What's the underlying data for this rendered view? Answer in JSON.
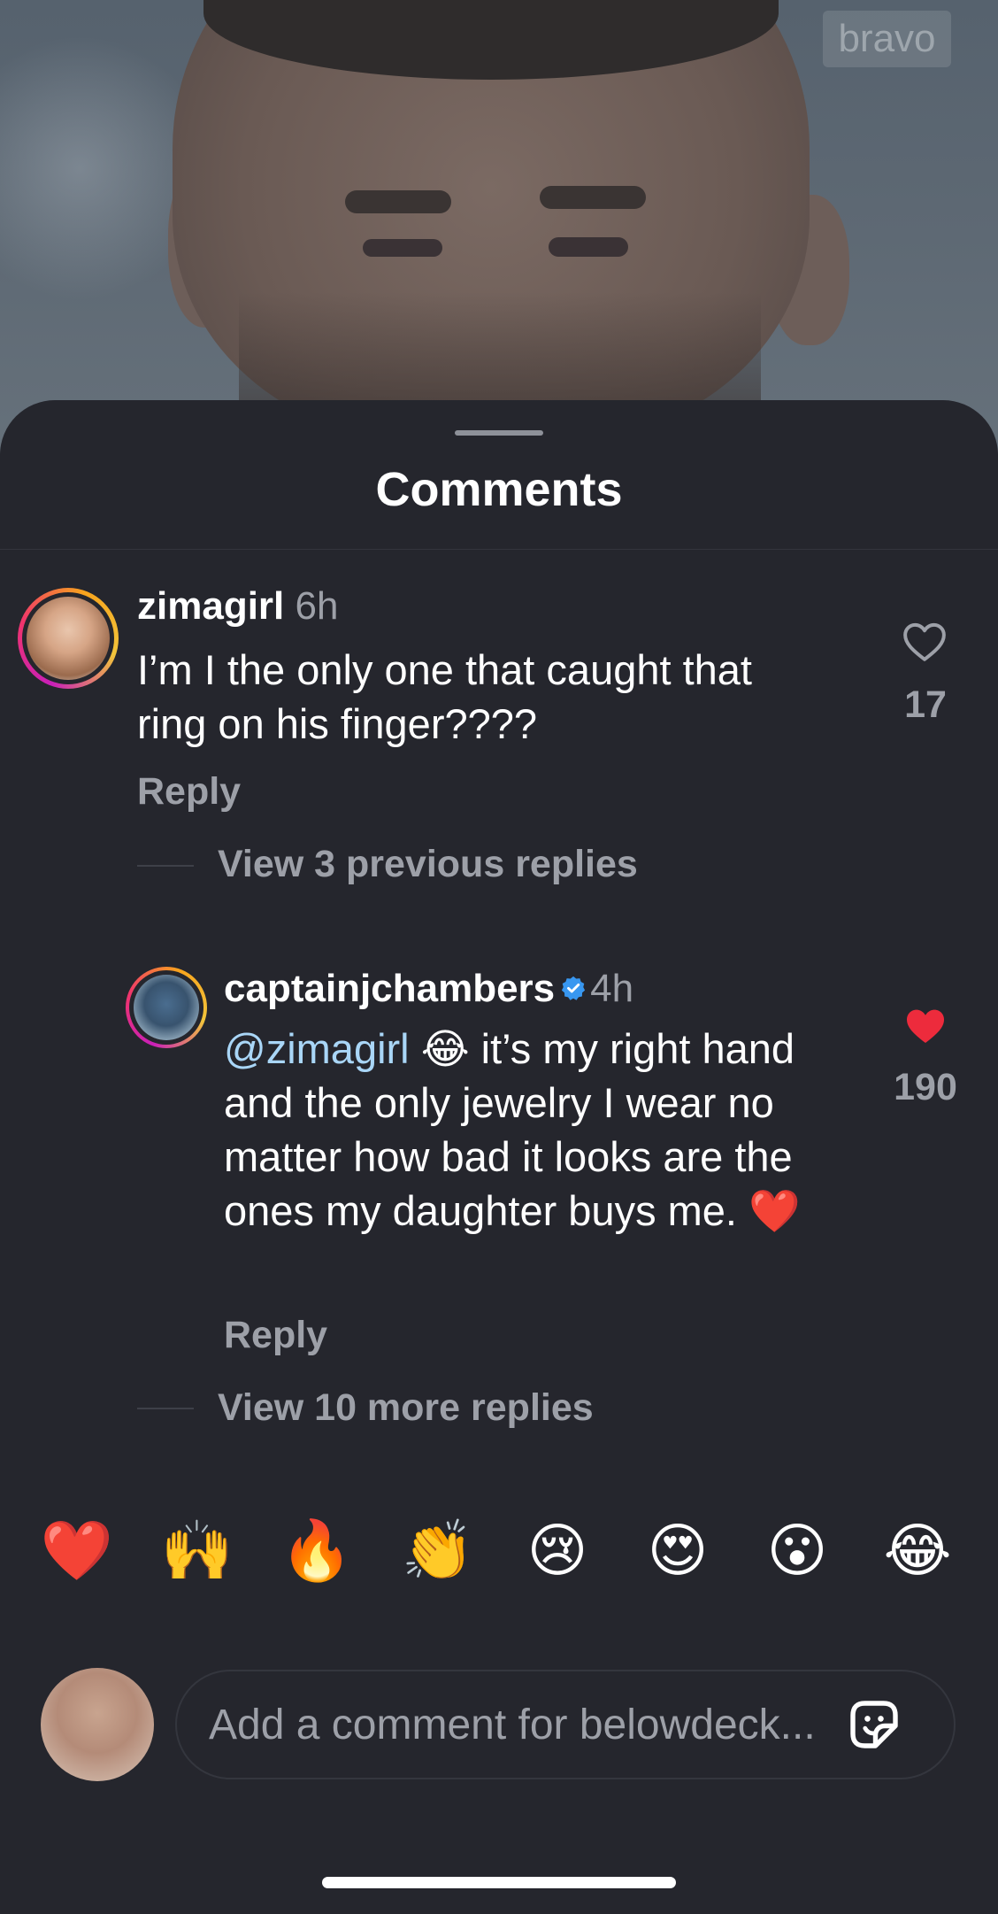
{
  "video": {
    "watermark": "bravo"
  },
  "sheet": {
    "title": "Comments"
  },
  "comments": [
    {
      "username": "zimagirl",
      "time": "6h",
      "text": "I’m I the only one that caught that ring on his finger????",
      "reply_label": "Reply",
      "likes": "17",
      "liked": false,
      "view_replies_label": "View 3 previous replies"
    }
  ],
  "replies": [
    {
      "username": "captainjchambers",
      "verified": true,
      "time": "4h",
      "mention": "@zimagirl",
      "emoji": "😂",
      "text": " it’s my right hand and the only jewelry I wear no matter how bad it looks are the ones my daughter buys me. ❤️",
      "reply_label": "Reply",
      "likes": "190",
      "liked": true,
      "view_more_label": "View 10 more replies"
    }
  ],
  "emoji_bar": [
    "❤️",
    "🙌",
    "🔥",
    "👏",
    "😢",
    "😍",
    "😮",
    "😂"
  ],
  "composer": {
    "placeholder": "Add a comment for belowdeck..."
  },
  "colors": {
    "background": "#25262d",
    "secondary_text": "#9da0a8",
    "mention": "#a9d6f7",
    "like_active": "#ed2b3c",
    "verified": "#3897f0"
  },
  "icons": {
    "like": "heart-outline-icon",
    "liked": "heart-filled-icon",
    "verified": "verified-badge-icon",
    "sticker": "sticker-icon"
  }
}
